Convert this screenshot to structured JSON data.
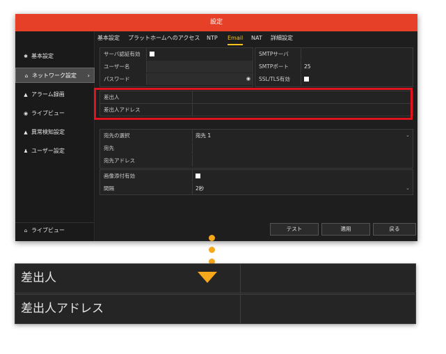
{
  "window": {
    "title": "設定"
  },
  "sidebar": {
    "items": [
      {
        "label": "基本設定",
        "icon": "gear-icon"
      },
      {
        "label": "ネットワーク設定",
        "icon": "network-icon",
        "active": true,
        "chevron": "›"
      },
      {
        "label": "アラーム録画",
        "icon": "alarm-icon"
      },
      {
        "label": "ライブビュー",
        "icon": "eye-icon"
      },
      {
        "label": "異常検知設定",
        "icon": "warning-icon"
      },
      {
        "label": "ユーザー設定",
        "icon": "users-icon"
      }
    ],
    "footer": {
      "label": "ライブビュー",
      "icon": "home-icon"
    }
  },
  "tabs": [
    "基本設定",
    "プラットホームへのアクセス",
    "NTP",
    "Email",
    "NAT",
    "詳細設定"
  ],
  "active_tab": "Email",
  "form": {
    "auth_label": "サーバ認証有効",
    "auth_checked": true,
    "user_label": "ユーザー名",
    "user_value": "",
    "password_label": "パスワード",
    "smtp_server_label": "SMTPサーバ",
    "smtp_server_value": "",
    "smtp_port_label": "SMTPポート",
    "smtp_port_value": "25",
    "ssl_label": "SSL/TLS有効",
    "ssl_checked": true,
    "sender_label": "差出人",
    "sender_value": "",
    "sender_addr_label": "差出人アドレス",
    "sender_addr_value": "",
    "recipient_select_label": "宛先の選択",
    "recipient_select_value": "宛先 1",
    "recipient_label": "宛先",
    "recipient_value": "",
    "recipient_addr_label": "宛先アドレス",
    "recipient_addr_value": "",
    "attach_label": "画像添付有効",
    "attach_checked": true,
    "interval_label": "間隔",
    "interval_value": "2秒"
  },
  "buttons": {
    "test": "テスト",
    "apply": "適用",
    "back": "戻る"
  },
  "zoom": {
    "sender_label": "差出人",
    "sender_addr_label": "差出人アドレス"
  },
  "colors": {
    "titlebar": "#e64029",
    "highlight": "#e0141e",
    "accent": "#f5a81c",
    "active_tab": "#f5c21b"
  }
}
